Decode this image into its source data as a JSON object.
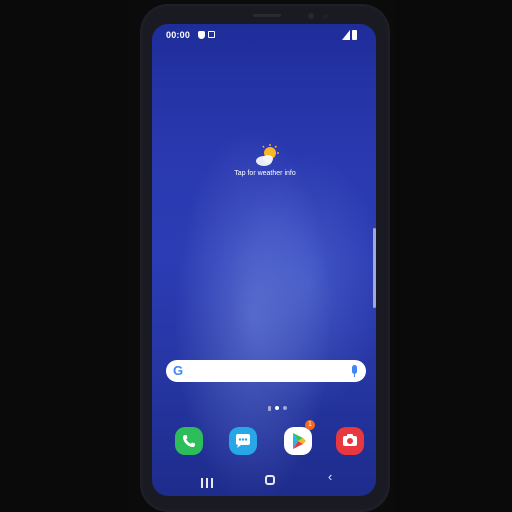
{
  "status_bar": {
    "time": "00:00",
    "icons": [
      "shield-icon",
      "screenshot-icon",
      "signal-icon",
      "battery-icon"
    ]
  },
  "weather_widget": {
    "icon": "weather-partly-cloudy-icon",
    "label": "Tap for weather info"
  },
  "search_bar": {
    "logo": "G",
    "icons": [
      "google-logo-icon",
      "microphone-icon"
    ]
  },
  "home_pages": {
    "count": 2,
    "current": 1
  },
  "dock": [
    {
      "name": "Phone",
      "icon": "phone-icon",
      "color": "#2dbd5a"
    },
    {
      "name": "Messages",
      "icon": "messages-icon",
      "color": "#28a7e6"
    },
    {
      "name": "Play Store",
      "icon": "play-store-icon",
      "color": "#ffffff",
      "badge": "1"
    },
    {
      "name": "Camera",
      "icon": "camera-icon",
      "color": "#e9373f"
    }
  ],
  "nav_bar": {
    "buttons": [
      "recent-apps-icon",
      "home-icon",
      "back-icon"
    ],
    "back_glyph": "‹"
  },
  "colors": {
    "wallpaper_top": "#1f2d9a",
    "wallpaper_mid": "#2b3cb4",
    "accent_google": "#4285f4"
  }
}
